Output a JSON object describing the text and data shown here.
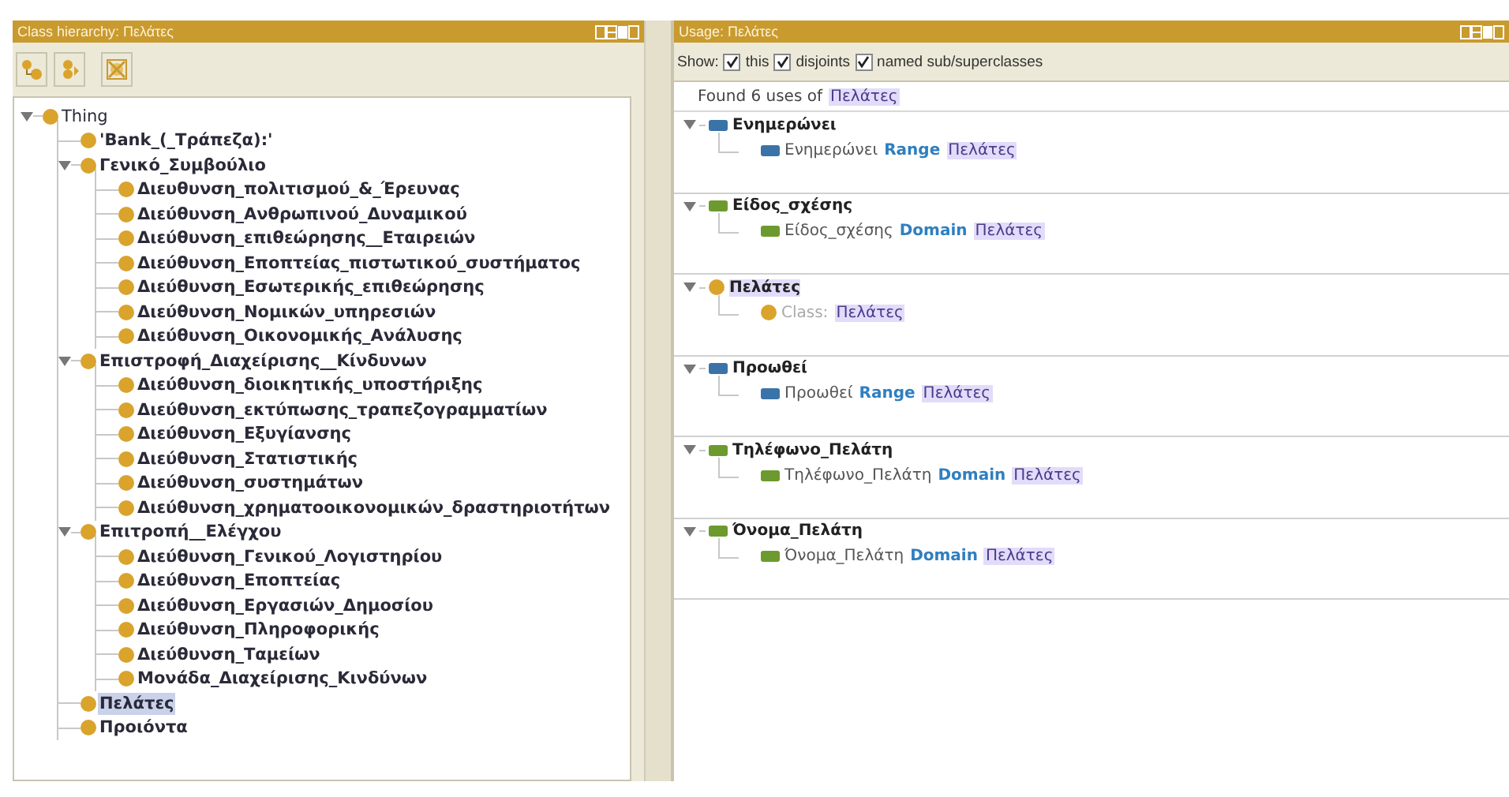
{
  "class_hierarchy": {
    "title": "Class hierarchy: Πελάτες",
    "tree": [
      {
        "label": "Thing",
        "expanded": true,
        "selected": false,
        "children": [
          {
            "label": "'Bank_(_Τράπεζα):'",
            "selected": false
          },
          {
            "label": "Γενικό_Συμβούλιο",
            "expanded": true,
            "selected": false,
            "children": [
              {
                "label": "Διευθυνση_πολιτισμού_&_Έρευνας",
                "selected": false
              },
              {
                "label": "Διεύθυνση_Ανθρωπινού_Δυναμικού",
                "selected": false
              },
              {
                "label": "Διεύθυνση_επιθεώρησης__Εταιρειών",
                "selected": false
              },
              {
                "label": "Διεύθυνση_Εποπτείας_πιστωτικού_συστήματος",
                "selected": false
              },
              {
                "label": "Διεύθυνση_Εσωτερικής_επιθεώρησης",
                "selected": false
              },
              {
                "label": "Διεύθυνση_Νομικών_υπηρεσιών",
                "selected": false
              },
              {
                "label": "Διεύθυνση_Οικονομικής_Ανάλυσης",
                "selected": false
              }
            ]
          },
          {
            "label": "Επιστροφή_Διαχείρισης__Κίνδυνων",
            "expanded": true,
            "selected": false,
            "children": [
              {
                "label": "Διεύθυνση_διοικητικής_υποστήριξης",
                "selected": false
              },
              {
                "label": "Διεύθυνση_εκτύπωσης_τραπεζογραμματίων",
                "selected": false
              },
              {
                "label": "Διεύθυνση_Εξυγίανσης",
                "selected": false
              },
              {
                "label": "Διεύθυνση_Στατιστικής",
                "selected": false
              },
              {
                "label": "Διεύθυνση_συστημάτων",
                "selected": false
              },
              {
                "label": "Διεύθυνση_χρηματοοικονομικών_δραστηριοτήτων",
                "selected": false
              }
            ]
          },
          {
            "label": "Επιτροπή__Ελέγχου",
            "expanded": true,
            "selected": false,
            "children": [
              {
                "label": "Διεύθυνση_Γενικού_Λογιστηρίου",
                "selected": false
              },
              {
                "label": "Διεύθυνση_Εποπτείας",
                "selected": false
              },
              {
                "label": "Διεύθυνση_Εργασιών_Δημοσίου",
                "selected": false
              },
              {
                "label": "Διεύθυνση_Πληροφορικής",
                "selected": false
              },
              {
                "label": "Διεύθυνση_Ταμείων",
                "selected": false
              },
              {
                "label": "Μονάδα_Διαχείρισης_Κινδύνων",
                "selected": false
              }
            ]
          },
          {
            "label": "Πελάτες",
            "selected": true
          },
          {
            "label": "Προιόντα",
            "selected": false
          }
        ]
      }
    ]
  },
  "usage": {
    "title": "Usage: Πελάτες",
    "show_label": "Show:",
    "options": [
      {
        "label": "this",
        "checked": true
      },
      {
        "label": "disjoints",
        "checked": true
      },
      {
        "label": "named sub/superclasses",
        "checked": true
      }
    ],
    "found": {
      "text": "Found 6 uses of",
      "entity": "Πελάτες"
    },
    "groups": [
      {
        "kind": "object_property",
        "title": "Ενημερώνει",
        "expanded": true,
        "highlighted": false,
        "usage": {
          "subject": "Ενημερώνει",
          "keyword": "Range",
          "object": "Πελάτες"
        }
      },
      {
        "kind": "data_property",
        "title": "Είδος_σχέσης",
        "expanded": true,
        "highlighted": false,
        "usage": {
          "subject": "Είδος_σχέσης",
          "keyword": "Domain",
          "object": "Πελάτες"
        }
      },
      {
        "kind": "class",
        "title": "Πελάτες",
        "expanded": true,
        "highlighted": true,
        "usage": {
          "keyword": "Class:",
          "object": "Πελάτες"
        }
      },
      {
        "kind": "object_property",
        "title": "Προωθεί",
        "expanded": true,
        "highlighted": false,
        "usage": {
          "subject": "Προωθεί",
          "keyword": "Range",
          "object": "Πελάτες"
        }
      },
      {
        "kind": "data_property",
        "title": "Τηλέφωνο_Πελάτη",
        "expanded": true,
        "highlighted": false,
        "usage": {
          "subject": "Τηλέφωνο_Πελάτη",
          "keyword": "Domain",
          "object": "Πελάτες"
        }
      },
      {
        "kind": "data_property",
        "title": "Όνομα_Πελάτη",
        "expanded": true,
        "highlighted": false,
        "usage": {
          "subject": "Όνομα_Πελάτη",
          "keyword": "Domain",
          "object": "Πελάτες"
        }
      }
    ]
  }
}
